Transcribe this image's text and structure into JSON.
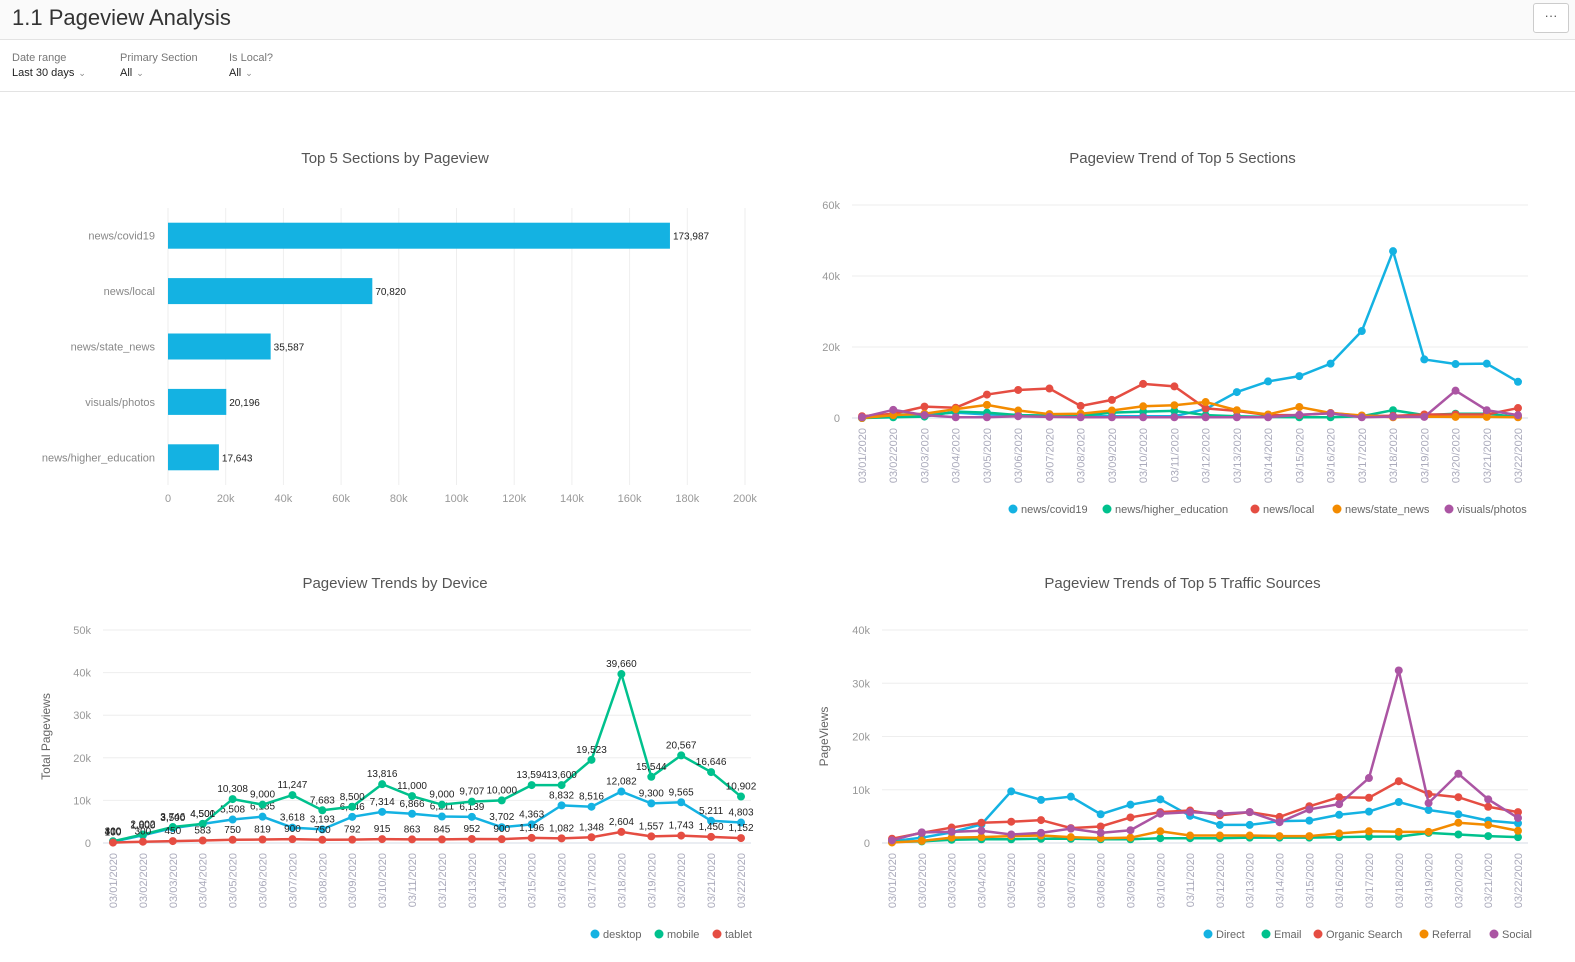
{
  "header": {
    "title": "1.1 Pageview Analysis",
    "more_label": "···"
  },
  "filters": [
    {
      "label": "Date range",
      "value": "Last 30 days"
    },
    {
      "label": "Primary Section",
      "value": "All"
    },
    {
      "label": "Is Local?",
      "value": "All"
    }
  ],
  "chart_data": [
    {
      "type": "bar",
      "orientation": "horizontal",
      "title": "Top 5 Sections by Pageview",
      "categories": [
        "news/covid19",
        "news/local",
        "news/state_news",
        "visuals/photos",
        "news/higher_education"
      ],
      "values": [
        173987,
        70820,
        35587,
        20196,
        17643
      ],
      "value_labels": [
        "173,987",
        "70,820",
        "35,587",
        "20,196",
        "17,643"
      ],
      "xlim": [
        0,
        200000
      ],
      "xticks": [
        "0",
        "20k",
        "40k",
        "60k",
        "80k",
        "100k",
        "120k",
        "140k",
        "160k",
        "180k",
        "200k"
      ],
      "color": "#14b2e2",
      "grid": true
    },
    {
      "type": "line",
      "title": "Pageview Trend of Top 5 Sections",
      "ylabel": "",
      "ylim": [
        0,
        60000
      ],
      "yticks": [
        "0",
        "20k",
        "40k",
        "60k"
      ],
      "legend": "bottom-right",
      "x": [
        "03/01/2020",
        "03/02/2020",
        "03/03/2020",
        "03/04/2020",
        "03/05/2020",
        "03/06/2020",
        "03/07/2020",
        "03/08/2020",
        "03/09/2020",
        "03/10/2020",
        "03/11/2020",
        "03/12/2020",
        "03/13/2020",
        "03/14/2020",
        "03/15/2020",
        "03/16/2020",
        "03/17/2020",
        "03/18/2020",
        "03/19/2020",
        "03/20/2020",
        "03/21/2020",
        "03/22/2020"
      ],
      "series": [
        {
          "name": "news/covid19",
          "color": "#14b2e2",
          "values": [
            0,
            1000,
            1000,
            1500,
            1000,
            800,
            500,
            500,
            500,
            500,
            500,
            2500,
            7300,
            10300,
            11800,
            15300,
            24500,
            47000,
            16500,
            15200,
            15300,
            10200
          ]
        },
        {
          "name": "news/higher_education",
          "color": "#00c18d",
          "values": [
            0,
            200,
            400,
            1800,
            1500,
            800,
            700,
            600,
            1500,
            1800,
            2000,
            800,
            500,
            300,
            200,
            200,
            500,
            2200,
            800,
            1200,
            1200,
            300
          ]
        },
        {
          "name": "news/local",
          "color": "#e54d42",
          "values": [
            500,
            1200,
            3200,
            2900,
            6600,
            7900,
            8300,
            3400,
            5100,
            9600,
            8900,
            2700,
            2000,
            800,
            800,
            1400,
            600,
            600,
            1000,
            1000,
            1000,
            2800
          ]
        },
        {
          "name": "news/state_news",
          "color": "#f38b00",
          "values": [
            0,
            800,
            1200,
            2500,
            3700,
            2100,
            1100,
            1200,
            2100,
            3300,
            3600,
            4500,
            2200,
            1000,
            3100,
            1400,
            700,
            200,
            400,
            300,
            300,
            200
          ]
        },
        {
          "name": "visuals/photos",
          "color": "#ab55a3",
          "values": [
            200,
            2300,
            800,
            200,
            200,
            500,
            300,
            200,
            200,
            200,
            200,
            200,
            200,
            200,
            900,
            1300,
            200,
            400,
            300,
            7700,
            2200,
            800
          ]
        }
      ]
    },
    {
      "type": "line",
      "title": "Pageview Trends by Device",
      "ylabel": "Total Pageviews",
      "ylim": [
        0,
        50000
      ],
      "yticks": [
        "0",
        "10k",
        "20k",
        "30k",
        "40k",
        "50k"
      ],
      "legend": "bottom-right",
      "data_labels": true,
      "x": [
        "03/01/2020",
        "03/02/2020",
        "03/03/2020",
        "03/04/2020",
        "03/05/2020",
        "03/06/2020",
        "03/07/2020",
        "03/08/2020",
        "03/09/2020",
        "03/10/2020",
        "03/11/2020",
        "03/12/2020",
        "03/13/2020",
        "03/14/2020",
        "03/15/2020",
        "03/16/2020",
        "03/17/2020",
        "03/18/2020",
        "03/19/2020",
        "03/20/2020",
        "03/21/2020",
        "03/22/2020"
      ],
      "series": [
        {
          "name": "desktop",
          "color": "#14b2e2",
          "values": [
            300,
            1800,
            3500,
            4500,
            5508,
            6185,
            3618,
            3193,
            6146,
            7314,
            6866,
            6211,
            6139,
            3702,
            4363,
            8832,
            8516,
            12082,
            9300,
            9565,
            5211,
            4803
          ]
        },
        {
          "name": "mobile",
          "color": "#00c18d",
          "values": [
            410,
            2002,
            3746,
            4501,
            10308,
            9000,
            11247,
            7683,
            8500,
            13816,
            11000,
            9000,
            9707,
            10000,
            13594,
            13600,
            19523,
            39660,
            15544,
            20567,
            16646,
            10902
          ]
        },
        {
          "name": "tablet",
          "color": "#e54d42",
          "values": [
            100,
            300,
            450,
            583,
            750,
            819,
            900,
            750,
            792,
            915,
            863,
            845,
            952,
            900,
            1196,
            1082,
            1348,
            2604,
            1557,
            1743,
            1450,
            1152
          ]
        }
      ]
    },
    {
      "type": "line",
      "title": "Pageview Trends of Top 5 Traffic Sources",
      "ylabel": "PageViews",
      "ylim": [
        0,
        40000
      ],
      "yticks": [
        "0",
        "10k",
        "20k",
        "30k",
        "40k"
      ],
      "legend": "bottom-right",
      "x": [
        "03/01/2020",
        "03/02/2020",
        "03/03/2020",
        "03/04/2020",
        "03/05/2020",
        "03/06/2020",
        "03/07/2020",
        "03/08/2020",
        "03/09/2020",
        "03/10/2020",
        "03/11/2020",
        "03/12/2020",
        "03/13/2020",
        "03/14/2020",
        "03/15/2020",
        "03/16/2020",
        "03/17/2020",
        "03/18/2020",
        "03/19/2020",
        "03/20/2020",
        "03/21/2020",
        "03/22/2020"
      ],
      "series": [
        {
          "name": "Direct",
          "color": "#14b2e2",
          "values": [
            300,
            1000,
            2000,
            3500,
            9700,
            8100,
            8700,
            5400,
            7200,
            8200,
            5100,
            3400,
            3400,
            4100,
            4200,
            5300,
            5900,
            7700,
            6200,
            5400,
            4200,
            3700
          ]
        },
        {
          "name": "Email",
          "color": "#00c18d",
          "values": [
            200,
            300,
            600,
            700,
            700,
            800,
            800,
            700,
            700,
            900,
            900,
            900,
            1000,
            1000,
            1000,
            1100,
            1200,
            1200,
            1900,
            1600,
            1300,
            1100
          ]
        },
        {
          "name": "Organic Search",
          "color": "#e54d42",
          "values": [
            800,
            1900,
            2900,
            3800,
            4000,
            4300,
            2800,
            3100,
            4800,
            5800,
            6100,
            5200,
            5800,
            4900,
            6900,
            8600,
            8500,
            11600,
            9200,
            8600,
            6800,
            5800
          ]
        },
        {
          "name": "Referral",
          "color": "#f38b00",
          "values": [
            100,
            400,
            1000,
            1100,
            1300,
            1400,
            1100,
            900,
            1000,
            2200,
            1400,
            1400,
            1400,
            1300,
            1300,
            1800,
            2200,
            2100,
            2100,
            3800,
            3400,
            2300
          ]
        },
        {
          "name": "Social",
          "color": "#ab55a3",
          "values": [
            500,
            2000,
            2100,
            2300,
            1600,
            1900,
            2700,
            1900,
            2400,
            5500,
            5800,
            5500,
            5800,
            3900,
            6300,
            7300,
            12200,
            32400,
            7500,
            13000,
            8200,
            4700
          ]
        }
      ]
    }
  ]
}
